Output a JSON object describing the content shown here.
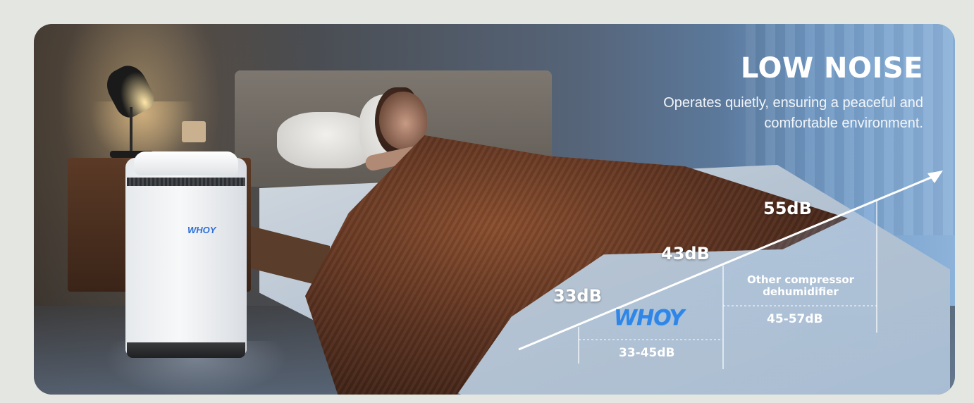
{
  "headline": "LOW NOISE",
  "subline_1": "Operates quietly, ensuring a peaceful and",
  "subline_2": "comfortable environment.",
  "product_logo_text": "WHOY",
  "brand_logo_text": "WHOY",
  "chart_data": {
    "type": "line",
    "levels": [
      "33dB",
      "43dB",
      "55dB"
    ],
    "ranges": [
      {
        "name": "WHOY",
        "label": "33-45dB",
        "min": 33,
        "max": 45
      },
      {
        "name": "Other compressor dehumidifier",
        "label": "45-57dB",
        "min": 45,
        "max": 57
      }
    ]
  },
  "other_label_1": "Other compressor",
  "other_label_2": "dehumidifier",
  "colors": {
    "accent_blue": "#2f86e6",
    "text_white": "#ffffff",
    "window_blue": "#6a93bf"
  }
}
